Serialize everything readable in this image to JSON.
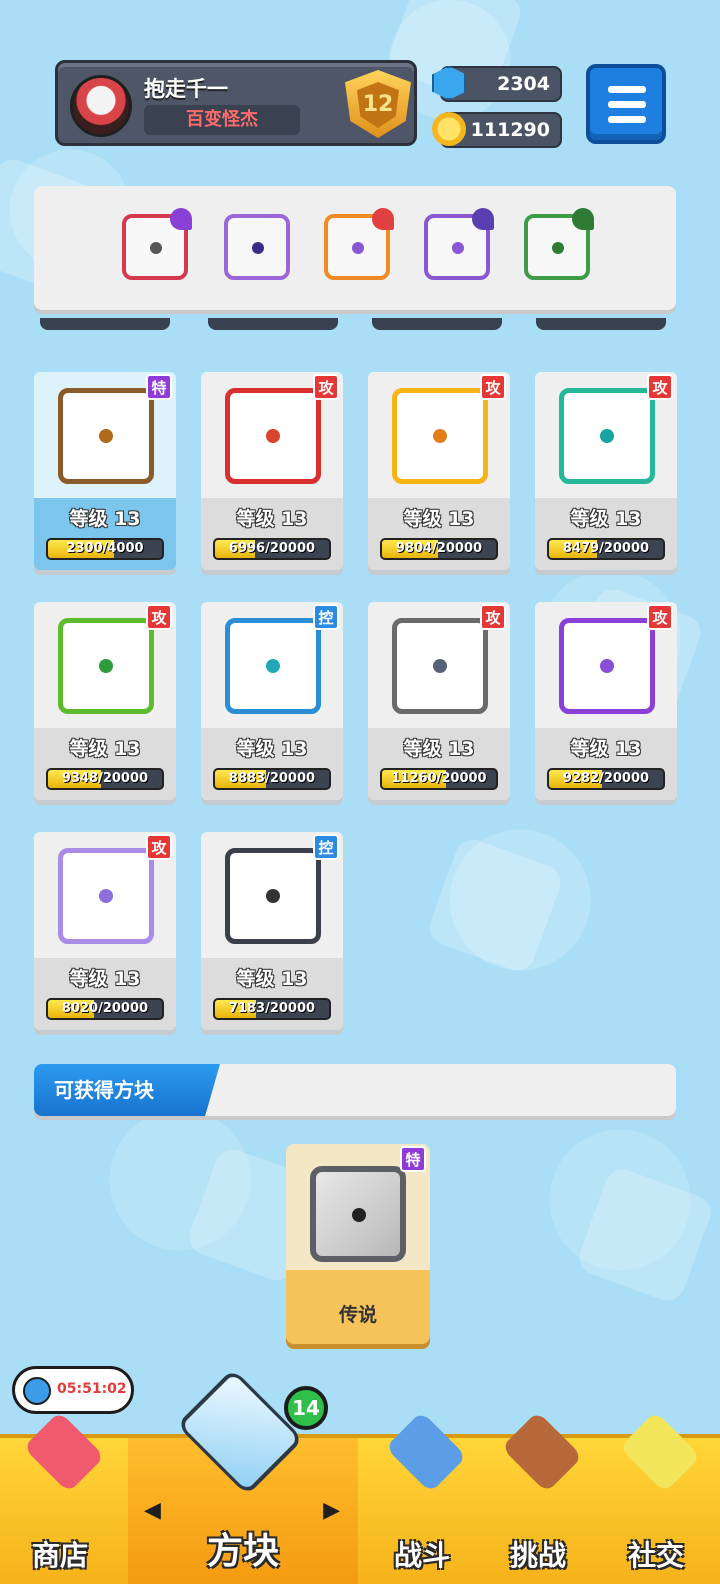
{
  "header": {
    "player_name": "抱走千一",
    "player_title": "百变怪杰",
    "rank": "12",
    "gems": "2304",
    "coins": "111290"
  },
  "deck": {
    "slots": [
      {
        "name": "saw",
        "color": "#d6384d"
      },
      {
        "name": "lightning",
        "color": "#9b66d9"
      },
      {
        "name": "infinity",
        "color": "#f08a24"
      },
      {
        "name": "arrow",
        "color": "#8a56d1"
      },
      {
        "name": "vine",
        "color": "#3e9b46"
      }
    ]
  },
  "cards": [
    {
      "level": "等级 13",
      "progress": "2300/4000",
      "fraction": 0.575,
      "tag": "特",
      "tag_type": "special",
      "frame": "#8a5a2b",
      "dot": "#b06a1b"
    },
    {
      "level": "等级 13",
      "progress": "6996/20000",
      "fraction": 0.35,
      "tag": "攻",
      "tag_type": "attack",
      "frame": "#d82f2f",
      "dot": "#d8462f"
    },
    {
      "level": "等级 13",
      "progress": "9804/20000",
      "fraction": 0.49,
      "tag": "攻",
      "tag_type": "attack",
      "frame": "#f5b517",
      "dot": "#e07f1b"
    },
    {
      "level": "等级 13",
      "progress": "8479/20000",
      "fraction": 0.424,
      "tag": "攻",
      "tag_type": "attack",
      "frame": "#25b79a",
      "dot": "#18a5a0"
    },
    {
      "level": "等级 13",
      "progress": "9348/20000",
      "fraction": 0.467,
      "tag": "攻",
      "tag_type": "attack",
      "frame": "#5dbb2e",
      "dot": "#2e9b3a"
    },
    {
      "level": "等级 13",
      "progress": "8883/20000",
      "fraction": 0.444,
      "tag": "控",
      "tag_type": "control",
      "frame": "#2a8ed6",
      "dot": "#20a8b8"
    },
    {
      "level": "等级 13",
      "progress": "11260/20000",
      "fraction": 0.563,
      "tag": "攻",
      "tag_type": "attack",
      "frame": "#6a6a6a",
      "dot": "#56627a"
    },
    {
      "level": "等级 13",
      "progress": "9282/20000",
      "fraction": 0.464,
      "tag": "攻",
      "tag_type": "attack",
      "frame": "#8a3fd6",
      "dot": "#8a4fd6"
    },
    {
      "level": "等级 13",
      "progress": "8020/20000",
      "fraction": 0.401,
      "tag": "攻",
      "tag_type": "attack",
      "frame": "#a98be8",
      "dot": "#8b6fe0"
    },
    {
      "level": "等级 13",
      "progress": "7183/20000",
      "fraction": 0.359,
      "tag": "控",
      "tag_type": "control",
      "frame": "#3a3f4a",
      "dot": "#333"
    }
  ],
  "obtainable": {
    "label": "可获得方块",
    "card_tag": "特",
    "card_rarity": "传说"
  },
  "timer": "05:51:02",
  "nav": {
    "shop": "商店",
    "dice": "方块",
    "dice_count": "14",
    "battle": "战斗",
    "challenge": "挑战",
    "social": "社交"
  }
}
